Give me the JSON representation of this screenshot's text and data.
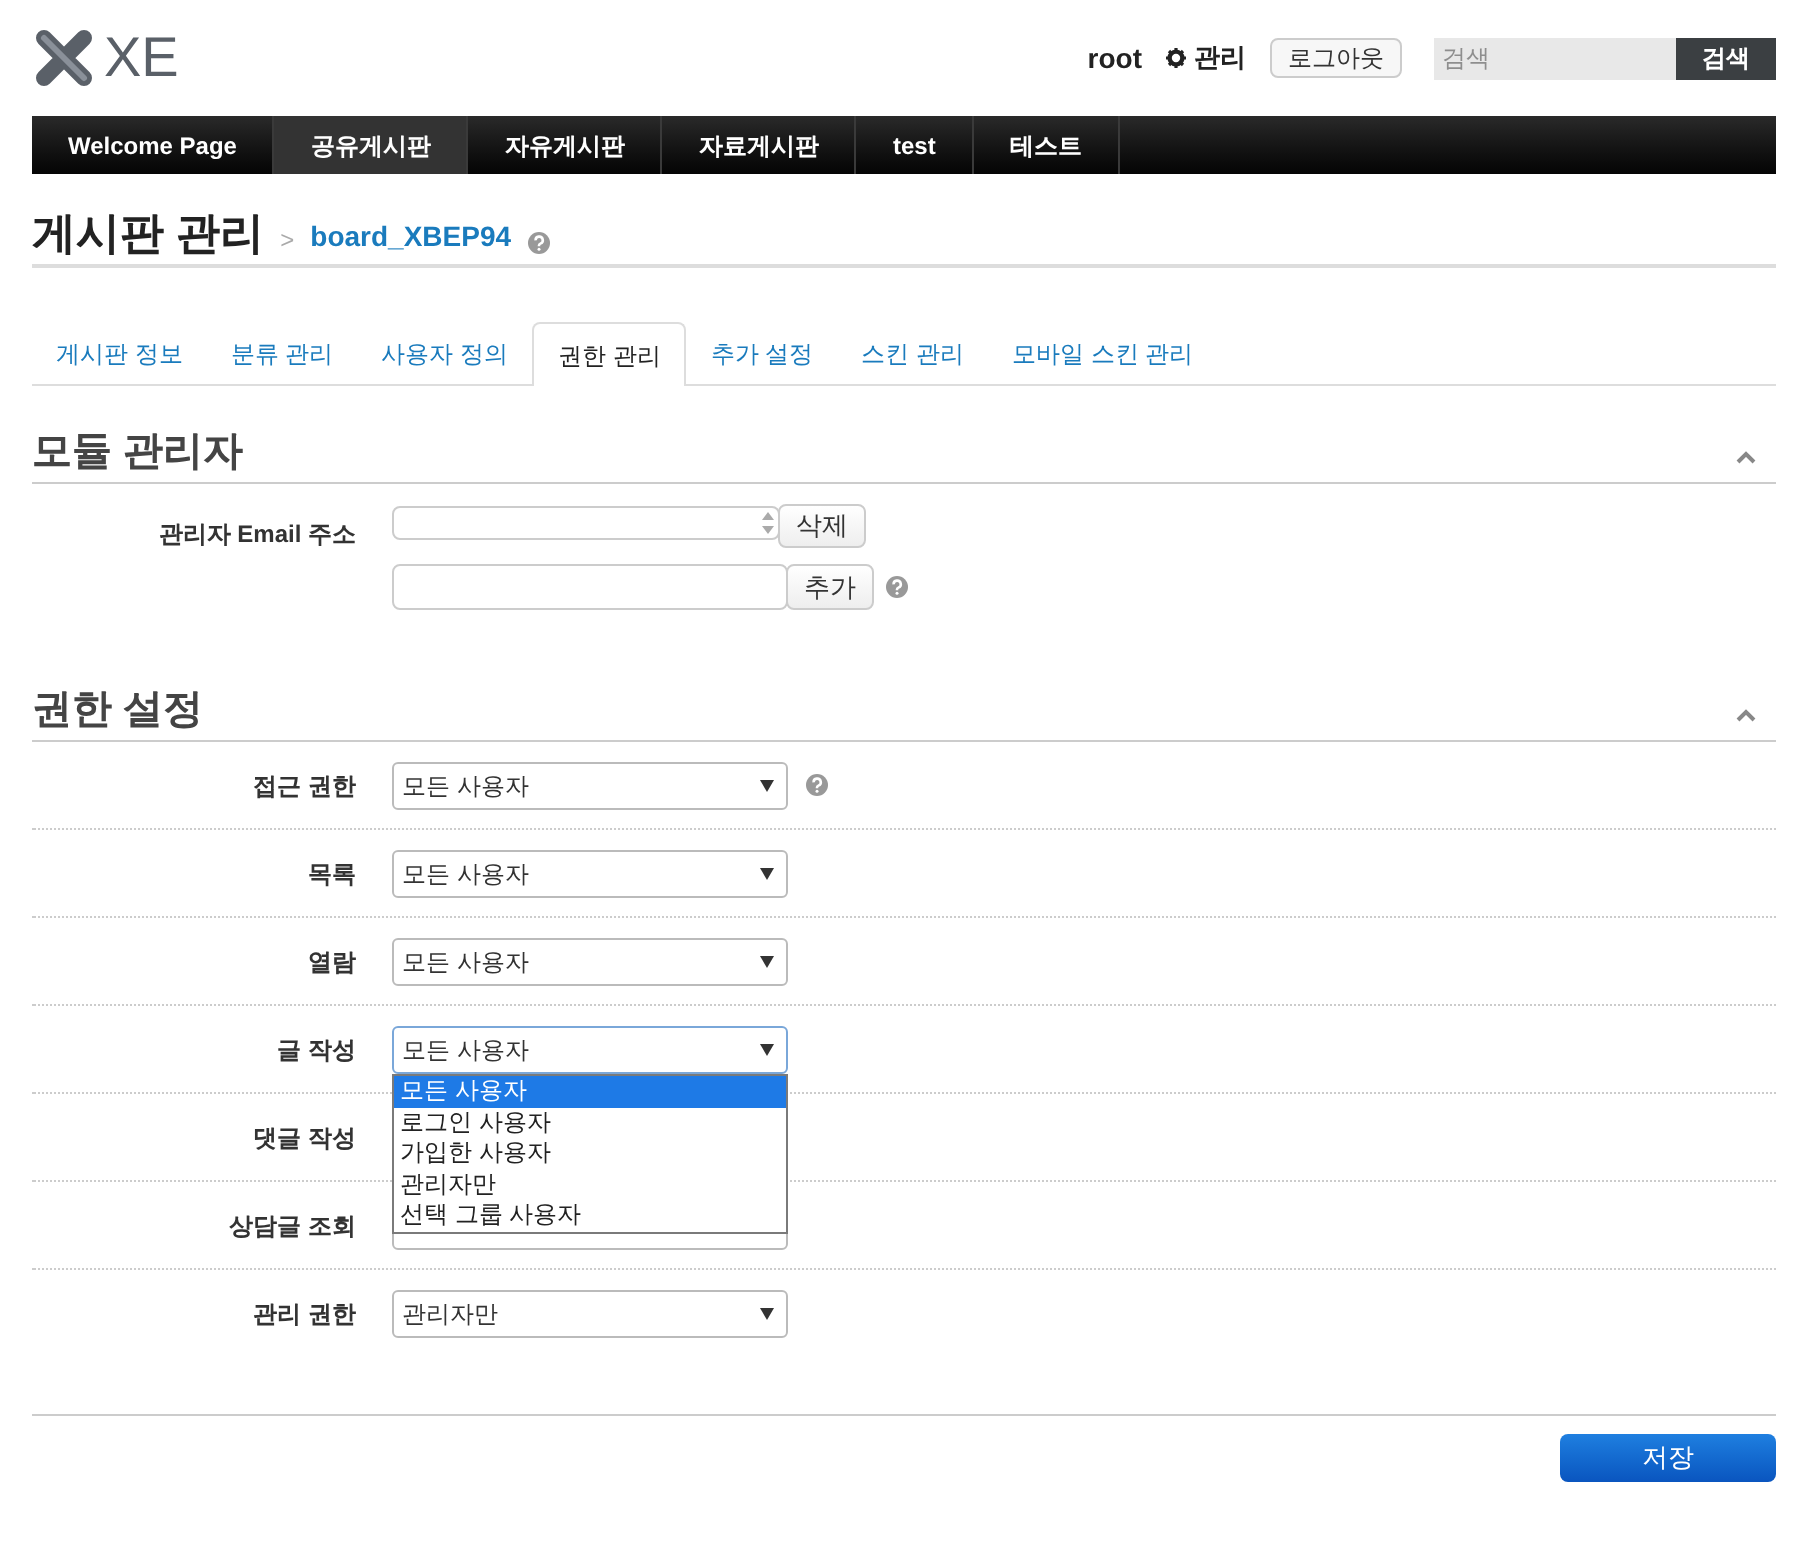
{
  "logo": {
    "text": "XE"
  },
  "account": {
    "user": "root",
    "admin_link": "관리",
    "logout": "로그아웃"
  },
  "search": {
    "placeholder": "검색",
    "button": "검색"
  },
  "nav": [
    {
      "label": "Welcome Page",
      "selected": false
    },
    {
      "label": "공유게시판",
      "selected": true
    },
    {
      "label": "자유게시판",
      "selected": false
    },
    {
      "label": "자료게시판",
      "selected": false
    },
    {
      "label": "test",
      "selected": false
    },
    {
      "label": "테스트",
      "selected": false
    }
  ],
  "page_title": "게시판 관리",
  "breadcrumb": {
    "separator": ">",
    "module": "board_XBEP94"
  },
  "tabs": [
    {
      "label": "게시판 정보",
      "selected": false
    },
    {
      "label": "분류 관리",
      "selected": false
    },
    {
      "label": "사용자 정의",
      "selected": false
    },
    {
      "label": "권한 관리",
      "selected": true
    },
    {
      "label": "추가 설정",
      "selected": false
    },
    {
      "label": "스킨 관리",
      "selected": false
    },
    {
      "label": "모바일 스킨 관리",
      "selected": false
    }
  ],
  "module_admin": {
    "title": "모듈 관리자",
    "expanded": true,
    "label": "관리자 Email 주소",
    "delete_button": "삭제",
    "add_button": "추가"
  },
  "permissions": {
    "title": "권한 설정",
    "expanded": true,
    "rows": [
      {
        "label": "접근 권한",
        "value": "모든 사용자",
        "help": true,
        "open": false
      },
      {
        "label": "목록",
        "value": "모든 사용자",
        "help": false,
        "open": false
      },
      {
        "label": "열람",
        "value": "모든 사용자",
        "help": false,
        "open": false
      },
      {
        "label": "글 작성",
        "value": "모든 사용자",
        "help": false,
        "open": true,
        "options": [
          {
            "label": "모든 사용자",
            "selected": true
          },
          {
            "label": "로그인 사용자",
            "selected": false
          },
          {
            "label": "가입한 사용자",
            "selected": false
          },
          {
            "label": "관리자만",
            "selected": false
          },
          {
            "label": "선택 그룹 사용자",
            "selected": false
          }
        ]
      },
      {
        "label": "댓글 작성",
        "help": false
      },
      {
        "label": "상담글 조회",
        "help": false,
        "open": false
      },
      {
        "label": "관리 권한",
        "value": "관리자만",
        "help": false,
        "open": false
      }
    ]
  },
  "save_button": "저장"
}
